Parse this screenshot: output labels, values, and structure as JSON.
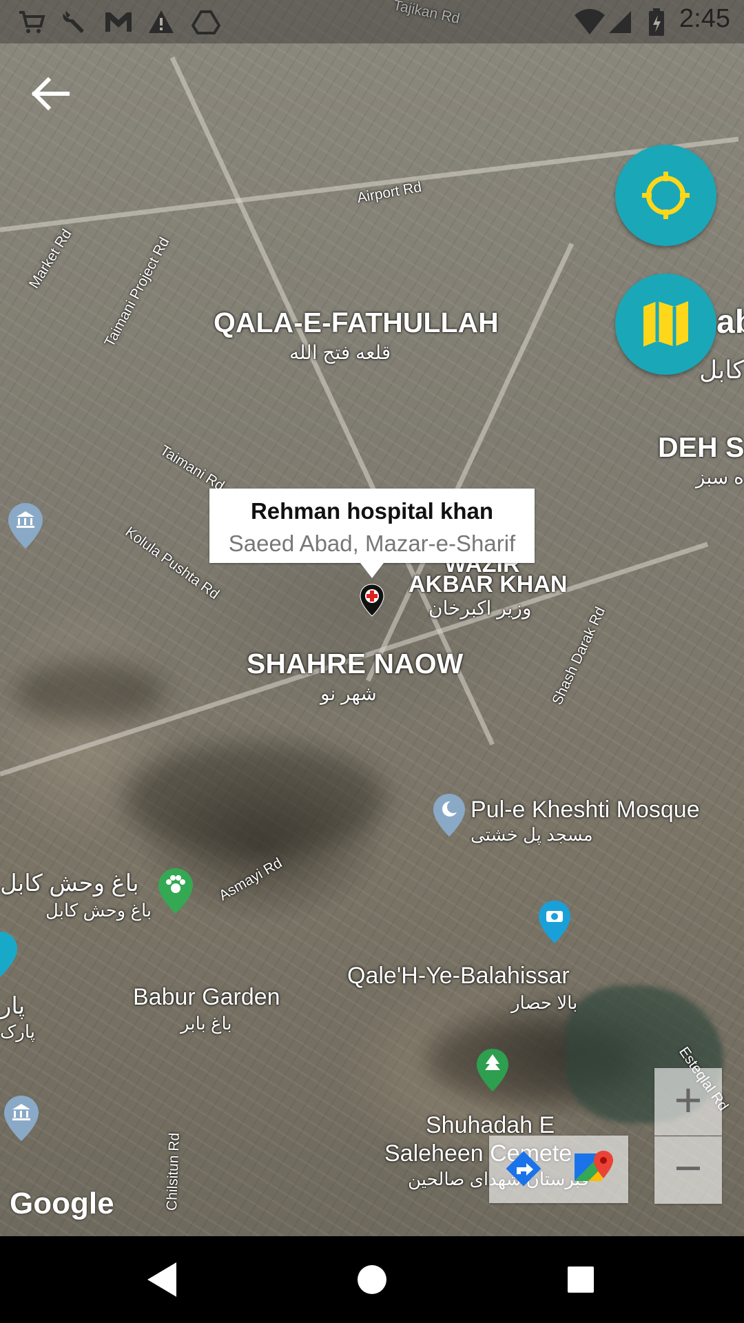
{
  "status_bar": {
    "time": "2:45",
    "left_icons": [
      "cart-icon",
      "wrench-icon",
      "gmail-icon",
      "warning-icon",
      "drive-icon"
    ],
    "right_icons": [
      "wifi-icon",
      "signal-icon",
      "battery-icon"
    ]
  },
  "map": {
    "provider_logo": "Google",
    "type": "satellite",
    "areas": [
      {
        "name": "QALA-E-FATHULLAH",
        "local": "قلعه فتح الله"
      },
      {
        "name": "SHAHRE NAOW",
        "local": "شهر نو"
      },
      {
        "name": "AKBAR KHAN",
        "local": "وزیر اکبرخان",
        "partial": "WAZIR"
      },
      {
        "name": "DEH SA",
        "local": "ه سبز"
      },
      {
        "name": "ab",
        "local": "کابل"
      }
    ],
    "pois": [
      {
        "name": "Pul-e Kheshti Mosque",
        "local": "مسجد پل خشتی",
        "icon": "mosque-icon"
      },
      {
        "name": "Babur Garden",
        "local": "باغ بابر"
      },
      {
        "name": "Qale'H-Ye-Balahissar",
        "local": "بالا حصار"
      },
      {
        "name": "Shuhadah E",
        "name2": "Saleheen Cemete",
        "local": "قبرستان شهدای صالحین",
        "icon": "tree-icon"
      },
      {
        "name": "باغ وحش کابل",
        "local": "باغ وحش کابل",
        "icon": "paw-icon"
      },
      {
        "name": "پار",
        "local": "پارک"
      }
    ],
    "roads": [
      "Tajikan Rd",
      "Airport Rd",
      "Market Rd",
      "Taimani Project Rd",
      "Taimani Rd",
      "Kolula Pushta Rd",
      "Shash Darak Rd",
      "Asmayi Rd",
      "Chilsitun Rd",
      "Esteqlal Rd"
    ]
  },
  "marker": {
    "title": "Rehman hospital khan",
    "subtitle": "Saeed Abad, Mazar-e-Sharif"
  },
  "controls": {
    "back": "arrow-left-icon",
    "my_location": "crosshair-icon",
    "map_type": "map-icon",
    "zoom_in": "+",
    "zoom_out": "−",
    "directions": "directions-icon",
    "open_maps": "google-maps-icon"
  },
  "nav_bar": {
    "buttons": [
      "back-triangle-icon",
      "home-circle-icon",
      "recents-square-icon"
    ]
  },
  "colors": {
    "fab": "#1aa7b8",
    "fab_icon": "#ffd71a"
  }
}
